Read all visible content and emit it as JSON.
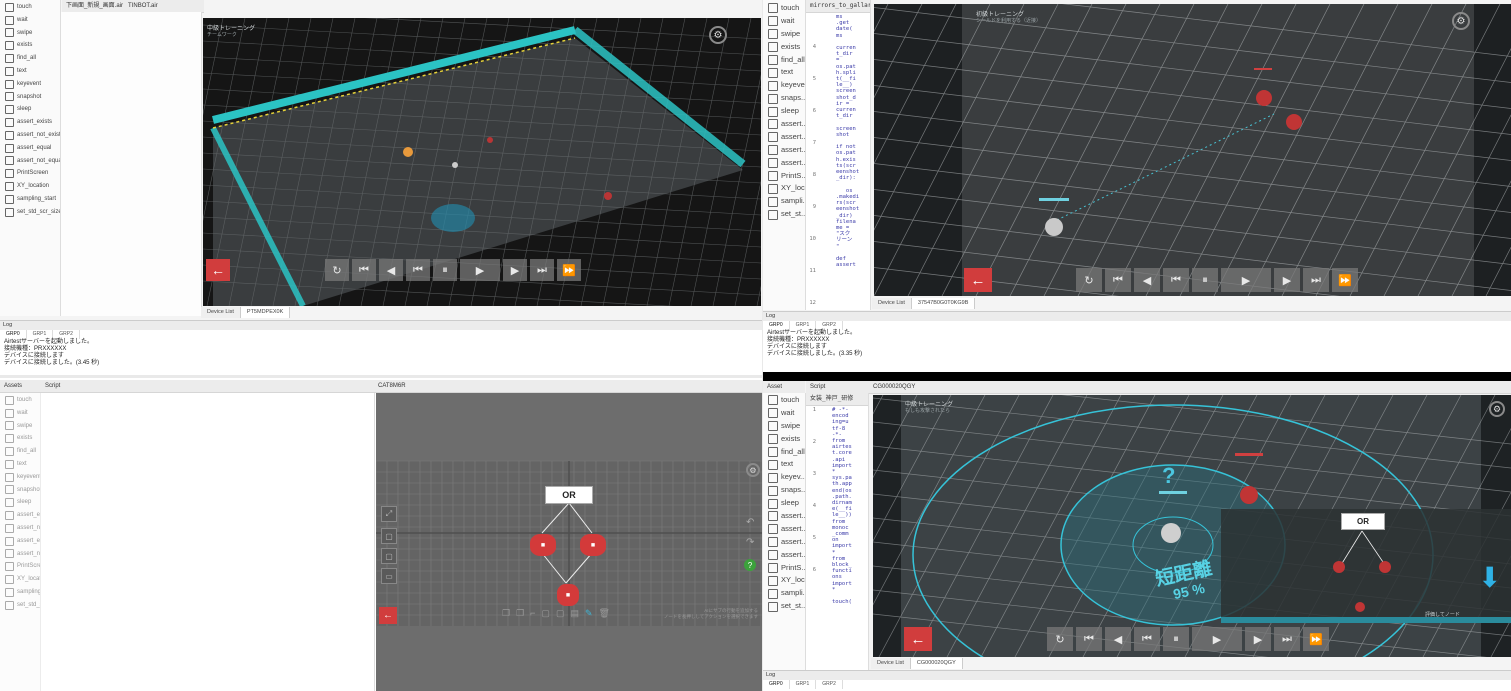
{
  "top_left": {
    "tabs": [
      "下画面_新規_画面.air",
      "TINBOT.air"
    ],
    "sidebar": [
      "touch",
      "wait",
      "swipe",
      "exists",
      "find_all",
      "text",
      "keyevent",
      "snapshot",
      "sleep",
      "assert_exists",
      "assert_not_exists",
      "assert_equal",
      "assert_not_equal",
      "PrintScreen",
      "XY_location",
      "sampling_start",
      "set_std_scr_size"
    ],
    "game_title": "中級トレーニング",
    "game_subtitle": "チームワーク",
    "bottom_tabs": [
      "Device List",
      "PT5MDPEX0K"
    ],
    "log": {
      "header": "Log",
      "tabs": [
        "GRP0",
        "GRP1",
        "GRP2"
      ],
      "lines": [
        "Airtestサーバーを起動しました。",
        "接続機種：PRXXXXXX",
        "デバイスに接続します",
        "デバイスに接続しました。(3.45 秒)"
      ]
    }
  },
  "top_right": {
    "sidebar": [
      "touch",
      "wait",
      "swipe",
      "exists",
      "find_all",
      "text",
      "keyeve...",
      "snaps...",
      "sleep",
      "assert...",
      "assert...",
      "assert...",
      "assert...",
      "PrintS...",
      "XY_loc...",
      "sampli...",
      "set_st..."
    ],
    "tab": "mirrors_to_gallar...",
    "line_numbers": [
      "4",
      "5",
      "6",
      "7",
      "8",
      "9",
      "10",
      "11",
      "12"
    ],
    "code": "ms\n.get\ndate(\nms\n\ncurren\nt_dir\n=\nos.pat\nh.spli\nt(__fi\nle__)\nscreen\nshot_d\nir =\ncurren\nt_dir\n\nscreen\nshot\n\nif not\nos.pat\nh.exis\nts(scr\neenshot\n_dir):\n\n   os\n.makedi\nrs(scr\neenshot\n_dir)\nfilena\nme =\n\"スク\nリーン\n\"\n\ndef\nassert",
    "game_title": "初級トレーニング",
    "game_subtitle": "シールドを利用する（近接）",
    "bottom_tabs": [
      "Device List",
      "37547B0G0T0KG9B"
    ],
    "log": {
      "header": "Log",
      "tabs": [
        "GRP0",
        "GRP1",
        "GRP2"
      ],
      "lines": [
        "Airtestサーバーを起動しました。",
        "接続機種：PRXXXXXX",
        "デバイスに接続します",
        "デバイスに接続しました。(3.35 秒)"
      ]
    }
  },
  "bottom_left": {
    "assets_header": "Assets",
    "script_header": "Script",
    "device_header": "CAT8M6R",
    "sidebar": [
      "touch",
      "wait",
      "swipe",
      "exists",
      "find_all",
      "text",
      "keyevent",
      "snapshot",
      "sleep",
      "assert_exists",
      "assert_not_...",
      "assert_equal",
      "assert_not_...",
      "PrintScreen",
      "XY_location",
      "sampling_s...",
      "set_std_scr..."
    ],
    "or_label": "OR",
    "hint_text": [
      "AIにサブの行動を追加する",
      "ノードを長押ししてアクションを選択できます"
    ]
  },
  "bottom_right": {
    "assets_header": "Asset",
    "script_header": "Script",
    "device_header": "CG000020QGY",
    "script_tab": "女装_神戸_研修",
    "sidebar": [
      "touch",
      "wait",
      "swipe",
      "exists",
      "find_all",
      "text",
      "keyev...",
      "snaps...",
      "sleep",
      "assert...",
      "assert...",
      "assert...",
      "assert...",
      "PrintS...",
      "XY_loc...",
      "sampli...",
      "set_st..."
    ],
    "line_numbers": [
      "1",
      "2",
      "3",
      "4",
      "5",
      "6"
    ],
    "code": "# -*-\nencod\ning=u\ntf-8\n-*-\nfrom\nairtes\nt.core\n.api\nimport\n*\nsys.pa\nth.app\nend(os\n.path.\ndirnam\ne(__fi\nle__))\nfrom\nmonoc\n_comm\non\nimport\n*\nfrom\nblock_\nfuncti\nons\nimport\n*\n\ntouch(",
    "game_title": "中級トレーニング",
    "game_subtitle": "もしも攻撃されたら",
    "short_range_label": "短距離",
    "short_range_percent": "95 %",
    "question_mark": "?",
    "or_label": "OR",
    "evaluate_text": "評価してノード",
    "bottom_tabs": [
      "Device List",
      "CG000020QGY"
    ],
    "log": {
      "header": "Log",
      "tabs": [
        "GRP0",
        "GRP1",
        "GRP2"
      ]
    }
  },
  "icons": {
    "back": "←",
    "gear": "⚙",
    "reload": "↻",
    "first": "⏮",
    "prev": "◀",
    "pause": "⏸",
    "play": "▶",
    "next": "▶",
    "last": "⏭",
    "fast": "⏩",
    "down_arrow": "⬇"
  },
  "colors": {
    "grid_bg": "#2e3336",
    "accent_red": "#d13d3d",
    "cyan": "#36c3d8"
  }
}
